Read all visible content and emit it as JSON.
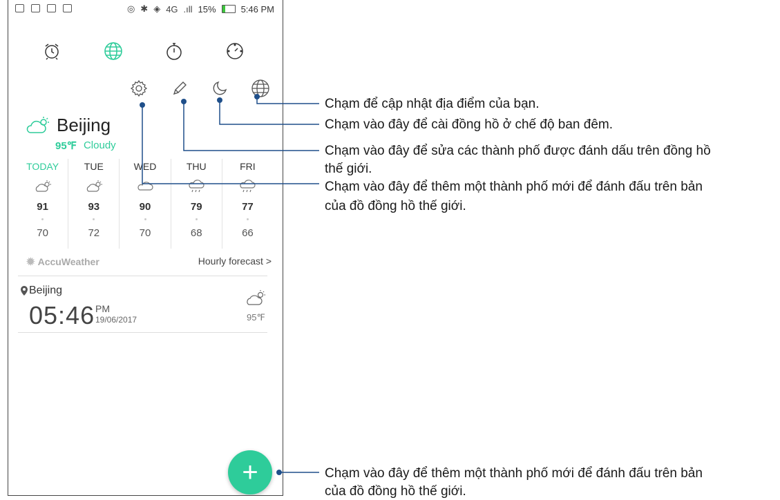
{
  "status_bar": {
    "network": "4G",
    "battery_percent": "15%",
    "time": "5:46 PM"
  },
  "tabs": [
    {
      "name": "alarm",
      "icon": "alarm-clock-icon",
      "active": false
    },
    {
      "name": "world-clock",
      "icon": "globe-icon",
      "active": true
    },
    {
      "name": "stopwatch",
      "icon": "stopwatch-icon",
      "active": false
    },
    {
      "name": "timer",
      "icon": "timer-icon",
      "active": false
    }
  ],
  "toolbar": {
    "icons": [
      "settings-gear-icon",
      "edit-pencil-icon",
      "night-mode-moon-icon",
      "world-globe-icon"
    ]
  },
  "weather": {
    "city": "Beijing",
    "current_temp": "95℉",
    "condition": "Cloudy",
    "forecast": [
      {
        "day": "TODAY",
        "high": "91",
        "low": "70",
        "icon": "partly-cloudy-icon"
      },
      {
        "day": "TUE",
        "high": "93",
        "low": "72",
        "icon": "partly-cloudy-icon"
      },
      {
        "day": "WED",
        "high": "90",
        "low": "70",
        "icon": "cloudy-icon"
      },
      {
        "day": "THU",
        "high": "79",
        "low": "68",
        "icon": "rain-cloud-icon"
      },
      {
        "day": "FRI",
        "high": "77",
        "low": "66",
        "icon": "rain-cloud-icon"
      }
    ],
    "provider": "AccuWeather",
    "hourly_link": "Hourly forecast >"
  },
  "world_clock": {
    "city": "Beijing",
    "time": "05:46",
    "ampm": "PM",
    "date": "19/06/2017",
    "temp": "95℉"
  },
  "fab": {
    "label": "+"
  },
  "callouts": [
    "Chạm để cập nhật địa điểm của bạn.",
    "Chạm vào đây để cài đồng hồ ở chế độ ban đêm.",
    "Chạm vào đây để sửa các thành phố được đánh dấu trên đồng hồ",
    "thế giới.",
    "Chạm vào đây để thêm một thành phố mới để đánh đấu trên bản",
    "của đồ đồng hồ thế giới.",
    "Chạm vào đây để thêm một thành phố mới để đánh đấu trên bản",
    "của đồ đồng hồ thế giới."
  ],
  "colors": {
    "accent": "#2ecc9a",
    "annotation": "#1f4f8a"
  }
}
